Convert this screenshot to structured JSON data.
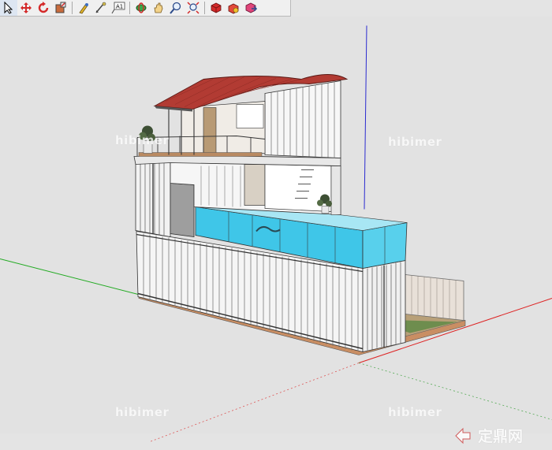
{
  "toolbar": {
    "items": [
      {
        "name": "select-tool-button",
        "icon": "arrow-icon"
      },
      {
        "name": "move-tool-button",
        "icon": "move-icon"
      },
      {
        "name": "rotate-tool-button",
        "icon": "rotate-icon"
      },
      {
        "name": "scale-tool-button",
        "icon": "scale-icon"
      },
      {
        "name": "paint-bucket-button",
        "icon": "paint-bucket-icon"
      },
      {
        "name": "tape-measure-button",
        "icon": "tape-measure-icon"
      },
      {
        "name": "text-tool-button",
        "icon": "text-icon",
        "label": "A1"
      },
      {
        "name": "orbit-tool-button",
        "icon": "orbit-icon"
      },
      {
        "name": "pan-tool-button",
        "icon": "hand-icon"
      },
      {
        "name": "zoom-tool-button",
        "icon": "zoom-icon"
      },
      {
        "name": "zoom-extents-button",
        "icon": "zoom-extents-icon"
      },
      {
        "name": "components-button",
        "icon": "components-icon"
      },
      {
        "name": "warehouse-button",
        "icon": "warehouse-icon"
      },
      {
        "name": "share-model-button",
        "icon": "share-icon"
      }
    ]
  },
  "watermarks": {
    "brand_small": "hibimer",
    "site_text": "定鼎网"
  },
  "colors": {
    "viewport_bg": "#e2e2e2",
    "roof": "#b83f36",
    "container": "#f4f4f4",
    "pool_water": "#39c6ea",
    "axis_red": "#cc2222",
    "axis_green": "#22aa22",
    "axis_blue": "#2222cc"
  }
}
